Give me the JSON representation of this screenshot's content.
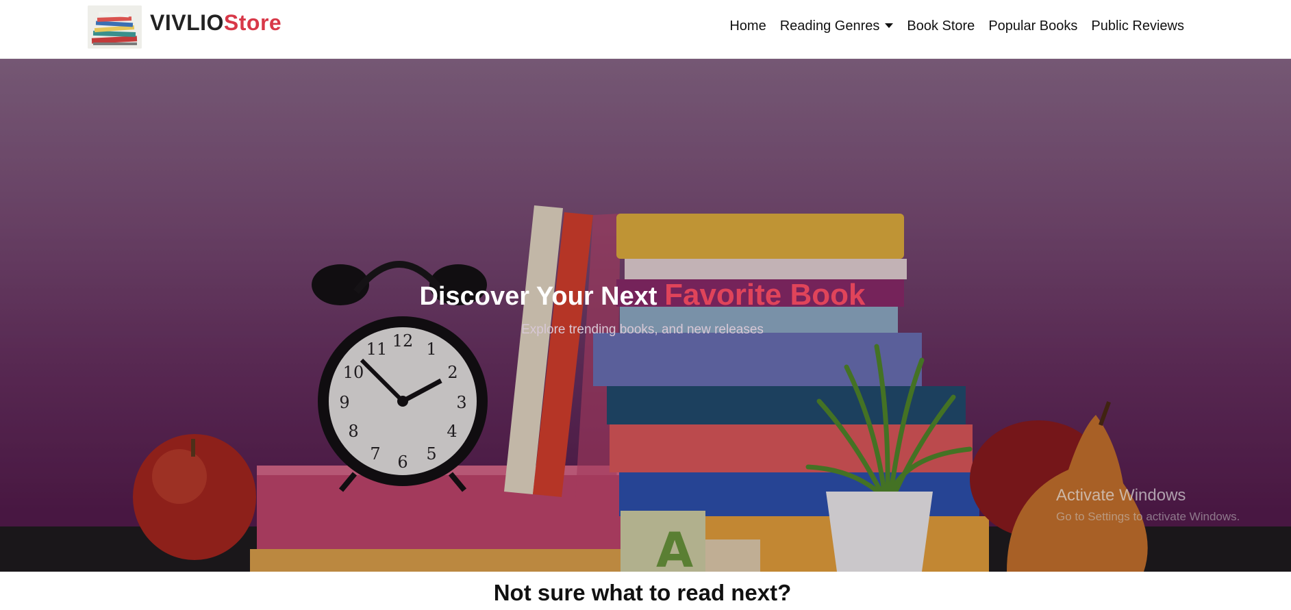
{
  "brand": {
    "name_main": "VIVLIO",
    "name_accent": "Store",
    "accent_color": "#d83848"
  },
  "nav": {
    "items": [
      {
        "label": "Home"
      },
      {
        "label": "Reading Genres",
        "has_dropdown": true
      },
      {
        "label": "Book Store"
      },
      {
        "label": "Popular Books"
      },
      {
        "label": "Public Reviews"
      }
    ]
  },
  "hero": {
    "title_plain": "Discover Your Next ",
    "title_accent": "Favorite Book",
    "subtitle": "Explore trending books, and new releases",
    "accent_color": "#e0445a"
  },
  "watermark": {
    "title": "Activate Windows",
    "subtitle": "Go to Settings to activate Windows."
  },
  "section": {
    "heading": "Not sure what to read next?"
  }
}
